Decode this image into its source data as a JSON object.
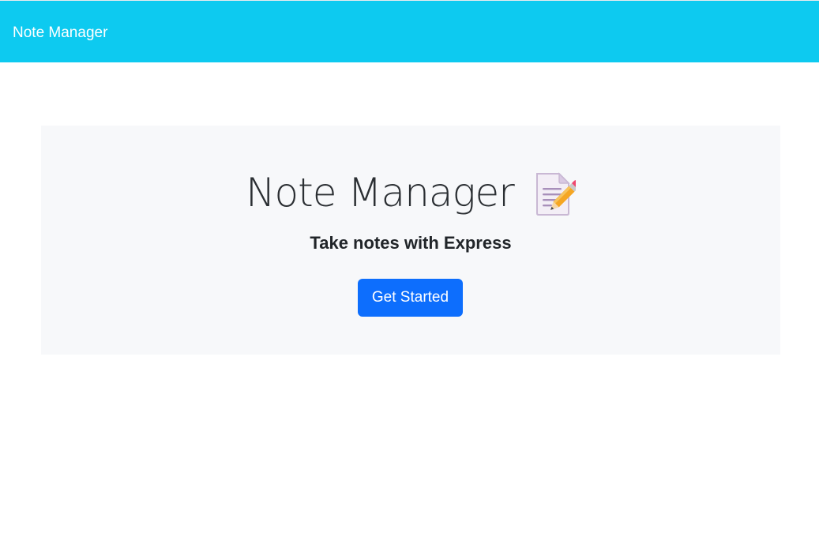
{
  "navbar": {
    "brand": "Note Manager",
    "background": "#0dcaf0"
  },
  "hero": {
    "title": "Note Manager",
    "icon": "memo-icon",
    "subtitle": "Take notes with Express",
    "cta_label": "Get Started",
    "cta_color": "#0d6efd"
  }
}
